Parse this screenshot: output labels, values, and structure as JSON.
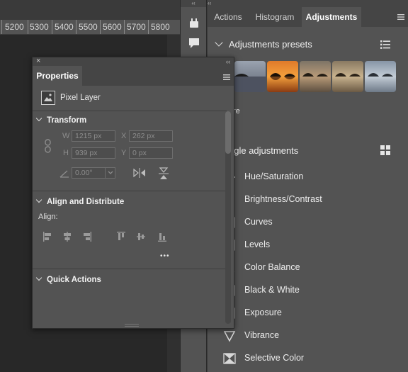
{
  "ruler": {
    "ticks": [
      "5200",
      "5300",
      "5400",
      "5500",
      "5600",
      "5700",
      "5800"
    ]
  },
  "dock": {
    "collapse_glyph": "‹‹"
  },
  "right_panel": {
    "collapse_glyph": "‹‹",
    "tabs": [
      {
        "label": "Actions"
      },
      {
        "label": "Histogram"
      },
      {
        "label": "Adjustments",
        "active": true
      }
    ],
    "presets_title": "Adjustments presets",
    "presets_more_label": "re",
    "single_title": "ngle adjustments",
    "items": [
      {
        "label": "Hue/Saturation",
        "icon": "hue-saturation-icon"
      },
      {
        "label": "Brightness/Contrast",
        "icon": "brightness-contrast-icon"
      },
      {
        "label": "Curves",
        "icon": "curves-icon"
      },
      {
        "label": "Levels",
        "icon": "levels-icon"
      },
      {
        "label": "Color Balance",
        "icon": "color-balance-icon"
      },
      {
        "label": "Black & White",
        "icon": "black-white-icon"
      },
      {
        "label": "Exposure",
        "icon": "exposure-icon"
      },
      {
        "label": "Vibrance",
        "icon": "vibrance-icon"
      },
      {
        "label": "Selective Color",
        "icon": "selective-color-icon"
      }
    ]
  },
  "properties": {
    "close_glyph": "×",
    "collapse_glyph": "‹‹",
    "tab_label": "Properties",
    "layer_type": "Pixel Layer",
    "transform": {
      "title": "Transform",
      "w_label": "W",
      "w_value": "1215 px",
      "x_label": "X",
      "x_value": "262 px",
      "h_label": "H",
      "h_value": "939 px",
      "y_label": "Y",
      "y_value": "0 px",
      "angle_value": "0.00°"
    },
    "align": {
      "title": "Align and Distribute",
      "align_label": "Align:",
      "more_glyph": "•••"
    },
    "quick_actions": {
      "title": "Quick Actions"
    }
  },
  "colors": {
    "panel": "#535353",
    "panel_dark": "#454545",
    "canvas": "#282828",
    "text": "#e8e8e8"
  }
}
